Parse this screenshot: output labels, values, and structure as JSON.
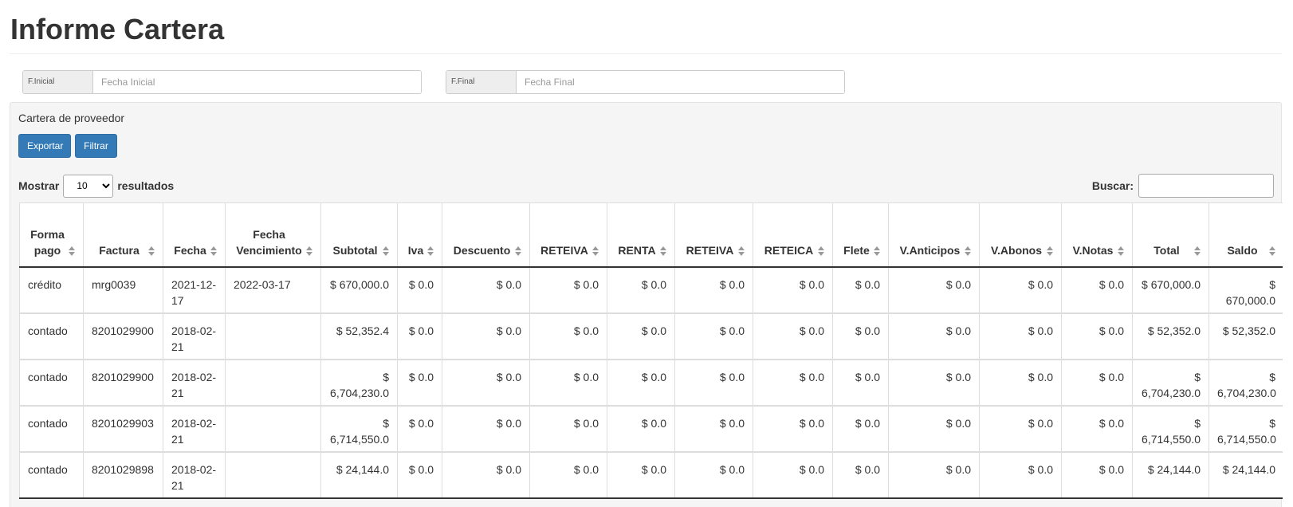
{
  "page": {
    "title": "Informe Cartera"
  },
  "filters": {
    "start": {
      "label": "F.Inicial",
      "placeholder": "Fecha Inicial"
    },
    "end": {
      "label": "F.Final",
      "placeholder": "Fecha Final"
    }
  },
  "panel": {
    "heading": "Cartera de proveedor",
    "export_label": "Exportar",
    "filter_label": "Filtrar",
    "length_prefix": "Mostrar",
    "length_value": "10",
    "length_suffix": "resultados",
    "search_label": "Buscar:"
  },
  "table": {
    "columns": [
      "Forma pago",
      "Factura",
      "Fecha",
      "Fecha Vencimiento",
      "Subtotal",
      "Iva",
      "Descuento",
      "RETEIVA",
      "RENTA",
      "RETEIVA",
      "RETEICA",
      "Flete",
      "V.Anticipos",
      "V.Abonos",
      "V.Notas",
      "Total",
      "Saldo"
    ],
    "rows": [
      [
        "crédito",
        "mrg0039",
        "2021-12-17",
        "2022-03-17",
        "$ 670,000.0",
        "$ 0.0",
        "$ 0.0",
        "$ 0.0",
        "$ 0.0",
        "$ 0.0",
        "$ 0.0",
        "$ 0.0",
        "$ 0.0",
        "$ 0.0",
        "$ 0.0",
        "$ 670,000.0",
        "$ 670,000.0"
      ],
      [
        "contado",
        "8201029900",
        "2018-02-21",
        "",
        "$ 52,352.4",
        "$ 0.0",
        "$ 0.0",
        "$ 0.0",
        "$ 0.0",
        "$ 0.0",
        "$ 0.0",
        "$ 0.0",
        "$ 0.0",
        "$ 0.0",
        "$ 0.0",
        "$ 52,352.0",
        "$ 52,352.0"
      ],
      [
        "contado",
        "8201029900",
        "2018-02-21",
        "",
        "$ 6,704,230.0",
        "$ 0.0",
        "$ 0.0",
        "$ 0.0",
        "$ 0.0",
        "$ 0.0",
        "$ 0.0",
        "$ 0.0",
        "$ 0.0",
        "$ 0.0",
        "$ 0.0",
        "$ 6,704,230.0",
        "$ 6,704,230.0"
      ],
      [
        "contado",
        "8201029903",
        "2018-02-21",
        "",
        "$ 6,714,550.0",
        "$ 0.0",
        "$ 0.0",
        "$ 0.0",
        "$ 0.0",
        "$ 0.0",
        "$ 0.0",
        "$ 0.0",
        "$ 0.0",
        "$ 0.0",
        "$ 0.0",
        "$ 6,714,550.0",
        "$ 6,714,550.0"
      ],
      [
        "contado",
        "8201029898",
        "2018-02-21",
        "",
        "$ 24,144.0",
        "$ 0.0",
        "$ 0.0",
        "$ 0.0",
        "$ 0.0",
        "$ 0.0",
        "$ 0.0",
        "$ 0.0",
        "$ 0.0",
        "$ 0.0",
        "$ 0.0",
        "$ 24,144.0",
        "$ 24,144.0"
      ]
    ]
  },
  "colors": {
    "primary": "#337ab7",
    "panel_bg": "#f5f5f5"
  },
  "icons": {
    "sort": "sort-both-icon"
  }
}
